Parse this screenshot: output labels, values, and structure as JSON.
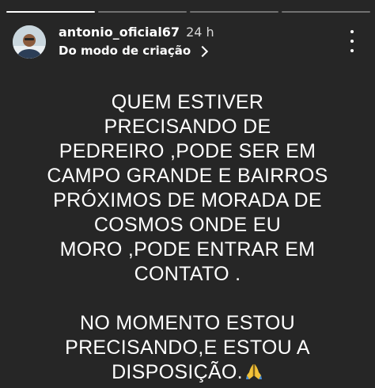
{
  "progress": {
    "segments": 4,
    "active": 1
  },
  "header": {
    "username": "antonio_oficial67",
    "time": "24 h",
    "source": "Do modo de criação",
    "avatar_icon": "profile-avatar",
    "menu_icon": "more-vertical-icon"
  },
  "story": {
    "lines": [
      "QUEM ESTIVER",
      "PRECISANDO DE",
      "PEDREIRO ,PODE SER EM",
      "CAMPO GRANDE E BAIRROS",
      "PRÓXIMOS DE MORADA DE",
      "COSMOS ONDE EU",
      "MORO ,PODE ENTRAR EM",
      "CONTATO ."
    ],
    "lines2": [
      "NO MOMENTO ESTOU",
      "PRECISANDO,E ESTOU A",
      "DISPOSIÇÃO."
    ],
    "emoji_icon": "folded-hands-icon"
  },
  "colors": {
    "background": "#262626",
    "text": "#ffffff",
    "emoji": "#f2c23a"
  }
}
